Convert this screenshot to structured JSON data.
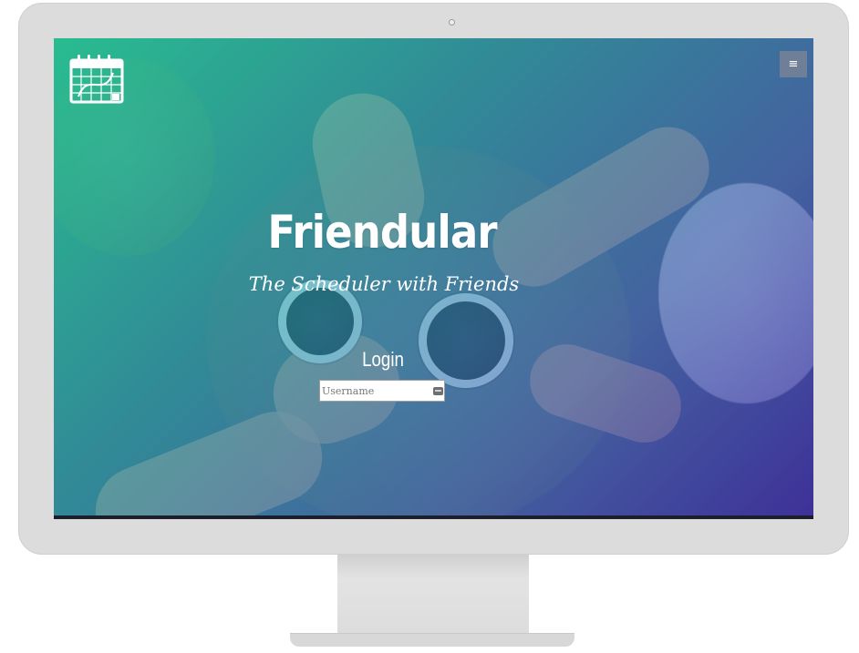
{
  "app": {
    "title": "Friendular",
    "subtitle": "The Scheduler with Friends"
  },
  "header": {
    "logo_icon": "calendar-icon",
    "menu_icon": "hamburger-menu-icon",
    "menu_label": "≡"
  },
  "login": {
    "heading": "Login",
    "username_placeholder": "Username",
    "username_value": "",
    "field_icon": "key-icon"
  },
  "colors": {
    "overlay_start": "#20dca0",
    "overlay_end": "#3c28aa",
    "text": "#ffffff",
    "bezel": "#dcdcdc"
  }
}
